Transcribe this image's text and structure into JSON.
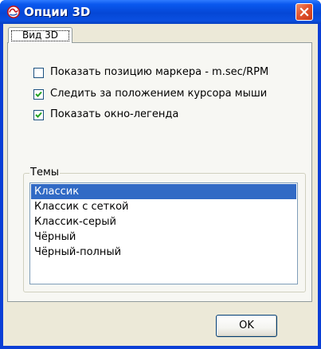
{
  "window": {
    "title": "Опции 3D"
  },
  "tabs": [
    {
      "label": "Вид 3D",
      "active": true
    }
  ],
  "options": [
    {
      "label": "Показать позицию маркера - m.sec/RPM",
      "checked": false
    },
    {
      "label": "Следить за положением курсора мыши",
      "checked": true
    },
    {
      "label": "Показать окно-легенда",
      "checked": true
    }
  ],
  "themes": {
    "label": "Темы",
    "items": [
      "Классик",
      "Классик с сеткой",
      "Классик-серый",
      "Чёрный",
      "Чёрный-полный"
    ],
    "selected": "Классик"
  },
  "buttons": {
    "ok": "OK"
  },
  "colors": {
    "titlebar": "#0a58ee",
    "selection": "#316ac5",
    "dialog_background": "#ece9d8",
    "close_button": "#e2532d"
  }
}
